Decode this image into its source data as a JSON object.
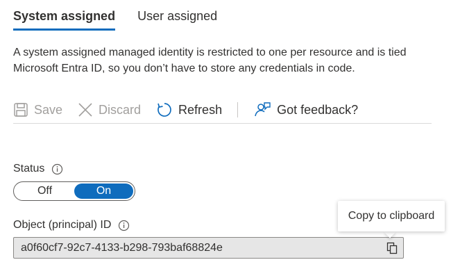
{
  "tabs": [
    {
      "label": "System assigned",
      "active": true
    },
    {
      "label": "User assigned",
      "active": false
    }
  ],
  "description": {
    "line1": "A system assigned managed identity is restricted to one per resource and is tied",
    "line2": "Microsoft Entra ID, so you don’t have to store any credentials in code."
  },
  "toolbar": {
    "save_label": "Save",
    "discard_label": "Discard",
    "refresh_label": "Refresh",
    "feedback_label": "Got feedback?"
  },
  "status": {
    "label": "Status",
    "off_label": "Off",
    "on_label": "On",
    "value": "On"
  },
  "object_id": {
    "label": "Object (principal) ID",
    "value": "a0f60cf7-92c7-4133-b298-793baf68824e"
  },
  "tooltip": {
    "text": "Copy to clipboard"
  },
  "colors": {
    "accent": "#0f6cbd",
    "disabled_text": "#a19f9d"
  }
}
